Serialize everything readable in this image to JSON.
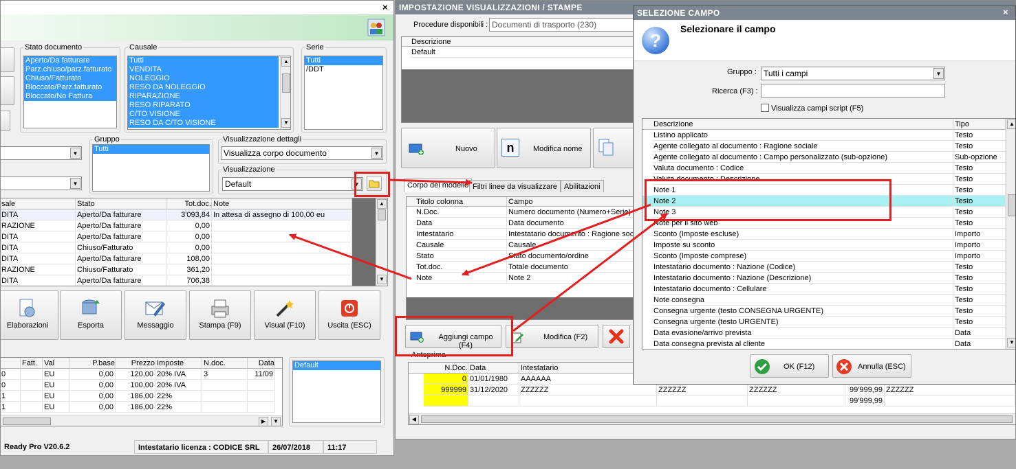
{
  "main": {
    "close_glyph": "×",
    "stato": {
      "label": "Stato documento",
      "items": [
        "Aperto/Da fatturare",
        "Parz.chiuso/parz.fatturato",
        "Chiuso/Fatturato",
        "Bloccato/Parz.fatturato",
        "Bloccato/No Fattura"
      ]
    },
    "causale": {
      "label": "Causale",
      "items": [
        "Tutti",
        "VENDITA",
        "NOLEGGIO",
        "RESO DA NOLEGGIO",
        "RIPARAZIONE",
        "RESO RIPARATO",
        "C/TO VISIONE",
        "RESO DA C/TO VISIONE"
      ]
    },
    "serie": {
      "label": "Serie",
      "items": [
        "Tutti",
        "/DDT"
      ]
    },
    "gruppo": {
      "label": "Gruppo",
      "items": [
        "Tutti"
      ]
    },
    "vis_dettagli": {
      "label": "Visualizzazione dettagli",
      "value": "Visualizza corpo documento"
    },
    "visualizzazione": {
      "label": "Visualizzazione",
      "value": "Default"
    },
    "grid": {
      "headers": [
        "sale",
        "Stato",
        "Tot.doc.",
        "Note"
      ],
      "rows": [
        [
          "DITA",
          "Aperto/Da fatturare",
          "3'093,84",
          "In attesa di assegno di 100,00 eu"
        ],
        [
          "RAZIONE",
          "Aperto/Da fatturare",
          "0,00",
          ""
        ],
        [
          "DITA",
          "Aperto/Da fatturare",
          "0,00",
          ""
        ],
        [
          "DITA",
          "Chiuso/Fatturato",
          "0,00",
          ""
        ],
        [
          "DITA",
          "Aperto/Da fatturare",
          "108,00",
          ""
        ],
        [
          "RAZIONE",
          "Chiuso/Fatturato",
          "361,20",
          ""
        ],
        [
          "DITA",
          "Aperto/Da fatturare",
          "706,38",
          ""
        ]
      ]
    },
    "toolbar": [
      "Elaborazioni",
      "Esporta",
      "Messaggio",
      "Stampa (F9)",
      "Visual (F10)",
      "Uscita (ESC)"
    ],
    "detail": {
      "headers": [
        "",
        "Fatt.",
        "Val",
        "P.base",
        "Prezzo",
        "Imposte",
        "N.doc.",
        "Data"
      ],
      "rows": [
        [
          "0",
          "",
          "EU",
          "0,00",
          "120,00",
          "20% IVA",
          "3",
          "11/09"
        ],
        [
          "0",
          "",
          "EU",
          "0,00",
          "100,00",
          "20% IVA",
          "",
          ""
        ],
        [
          "1",
          "",
          "EU",
          "0,00",
          "186,00",
          "22%",
          "",
          ""
        ],
        [
          "1",
          "",
          "EU",
          "0,00",
          "186,00",
          "22%",
          "",
          ""
        ]
      ]
    },
    "side_list": [
      "Default"
    ],
    "status": {
      "app": "Ready Pro V20.6.2",
      "license": "Intestatario licenza : CODICE SRL",
      "date": "26/07/2018",
      "time": "11:17"
    }
  },
  "imp": {
    "title": "IMPOSTAZIONE VISUALIZZAZIONI / STAMPE",
    "procedure_label": "Procedure disponibili :",
    "procedure_value": "Documenti di trasporto (230)",
    "desc_header": "Descrizione",
    "desc_rows": [
      "Default"
    ],
    "btn_nuovo": "Nuovo",
    "btn_modifica_nome": "Modifica nome",
    "tabs": [
      "Corpo del modello",
      "Filtri linee da visualizzare",
      "Abilitazioni"
    ],
    "cols": {
      "headers": [
        "Titolo colonna",
        "Campo"
      ],
      "rows": [
        [
          "N.Doc.",
          "Numero documento (Numero+Serie)"
        ],
        [
          "Data",
          "Data documento"
        ],
        [
          "Intestatario",
          "Intestatario documento : Ragione sociale"
        ],
        [
          "Causale",
          "Causale"
        ],
        [
          "Stato",
          "Stato documento/ordine"
        ],
        [
          "Tot.doc.",
          "Totale documento"
        ],
        [
          "Note",
          "Note 2"
        ]
      ]
    },
    "btn_aggiungi": "Aggiungi campo (F4)",
    "btn_modifica": "Modifica (F2)",
    "anteprima_label": "Anteprima",
    "preview": {
      "headers": [
        "N.Doc.",
        "Data",
        "Intestatario"
      ],
      "rows": [
        [
          "0",
          "01/01/1980",
          "AAAAAA",
          "",
          "",
          "",
          ""
        ],
        [
          "999999",
          "31/12/2020",
          "ZZZZZZ",
          "ZZZZZZ",
          "ZZZZZZ",
          "99'999,99",
          "ZZZZZZ"
        ],
        [
          "",
          "",
          "",
          "",
          "",
          "99'999,99",
          ""
        ]
      ]
    }
  },
  "sel": {
    "title": "SELEZIONE CAMPO",
    "heading": "Selezionare il campo",
    "gruppo_label": "Gruppo :",
    "gruppo_value": "Tutti i campi",
    "ricerca_label": "Ricerca (F3) :",
    "ricerca_value": "",
    "script_label": "Visualizza campi script (F5)",
    "headers": [
      "Descrizione",
      "Tipo"
    ],
    "rows": [
      [
        "Listino applicato",
        "Testo"
      ],
      [
        "Agente collegato al documento : Ragione sociale",
        "Testo"
      ],
      [
        "Agente collegato al documento : Campo personalizzato (sub-opzione)",
        "Sub-opzione"
      ],
      [
        "Valuta documento : Codice",
        "Testo"
      ],
      [
        "Valuta documento : Descrizione",
        "Testo"
      ],
      [
        "Note 1",
        "Testo"
      ],
      [
        "Note 2",
        "Testo"
      ],
      [
        "Note 3",
        "Testo"
      ],
      [
        "Note per il sito web",
        "Testo"
      ],
      [
        "Sconto (Imposte escluse)",
        "Importo"
      ],
      [
        "Imposte su sconto",
        "Importo"
      ],
      [
        "Sconto (Imposte comprese)",
        "Importo"
      ],
      [
        "Intestatario documento : Nazione (Codice)",
        "Testo"
      ],
      [
        "Intestatario documento : Nazione (Descrizione)",
        "Testo"
      ],
      [
        "Intestatario documento : Cellulare",
        "Testo"
      ],
      [
        "Note consegna",
        "Testo"
      ],
      [
        "Consegna urgente (testo CONSEGNA URGENTE)",
        "Testo"
      ],
      [
        "Consegna urgente (testo URGENTE)",
        "Testo"
      ],
      [
        "Data evasione/arrivo prevista",
        "Data"
      ],
      [
        "Data consegna prevista al cliente",
        "Data"
      ]
    ],
    "selected_index": 6,
    "ok": "OK (F12)",
    "annulla": "Annulla (ESC)",
    "close_glyph": "×"
  },
  "colors": {
    "selection": "#3399ff",
    "highlight_row": "#a9f0f0",
    "annotation": "#e21e1e",
    "titlebar": "#7d8690"
  }
}
